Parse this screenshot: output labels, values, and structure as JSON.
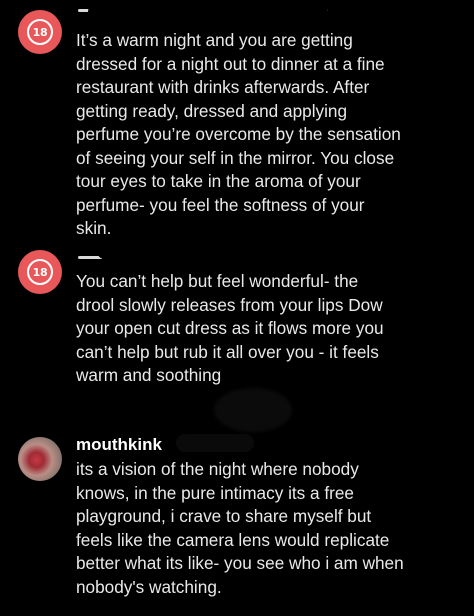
{
  "comments": [
    {
      "avatar": "age-18-badge",
      "avatar_text": "18",
      "username": "",
      "text": "It’s a warm night and you are getting\ndressed for a night out to dinner at a fine\nrestaurant with drinks afterwards. After\ngetting ready, dressed and applying\nperfume you’re overcome by the sensation\nof seeing your self in the mirror. You close\ntour eyes to take in the aroma of your\nperfume- you feel the softness of your\nskin."
    },
    {
      "avatar": "age-18-badge",
      "avatar_text": "18",
      "username": "",
      "text": "You can’t help but feel wonderful- the\ndrool slowly releases from your lips Dow\nyour open cut dress as it flows more you\ncan’t help but rub it all over you - it feels\nwarm and soothing"
    },
    {
      "avatar": "profile-photo",
      "username": "mouthkink",
      "text": "its a vision of the night where nobody\nknows, in the pure intimacy its a free\nplayground, i crave to share myself but\nfeels like the camera lens would replicate\nbetter what its like- you see who i am when\nnobody's watching."
    }
  ],
  "colors": {
    "background": "#000000",
    "text": "#e9e9e9",
    "username": "#ffffff",
    "age_badge": "#e8585a"
  }
}
